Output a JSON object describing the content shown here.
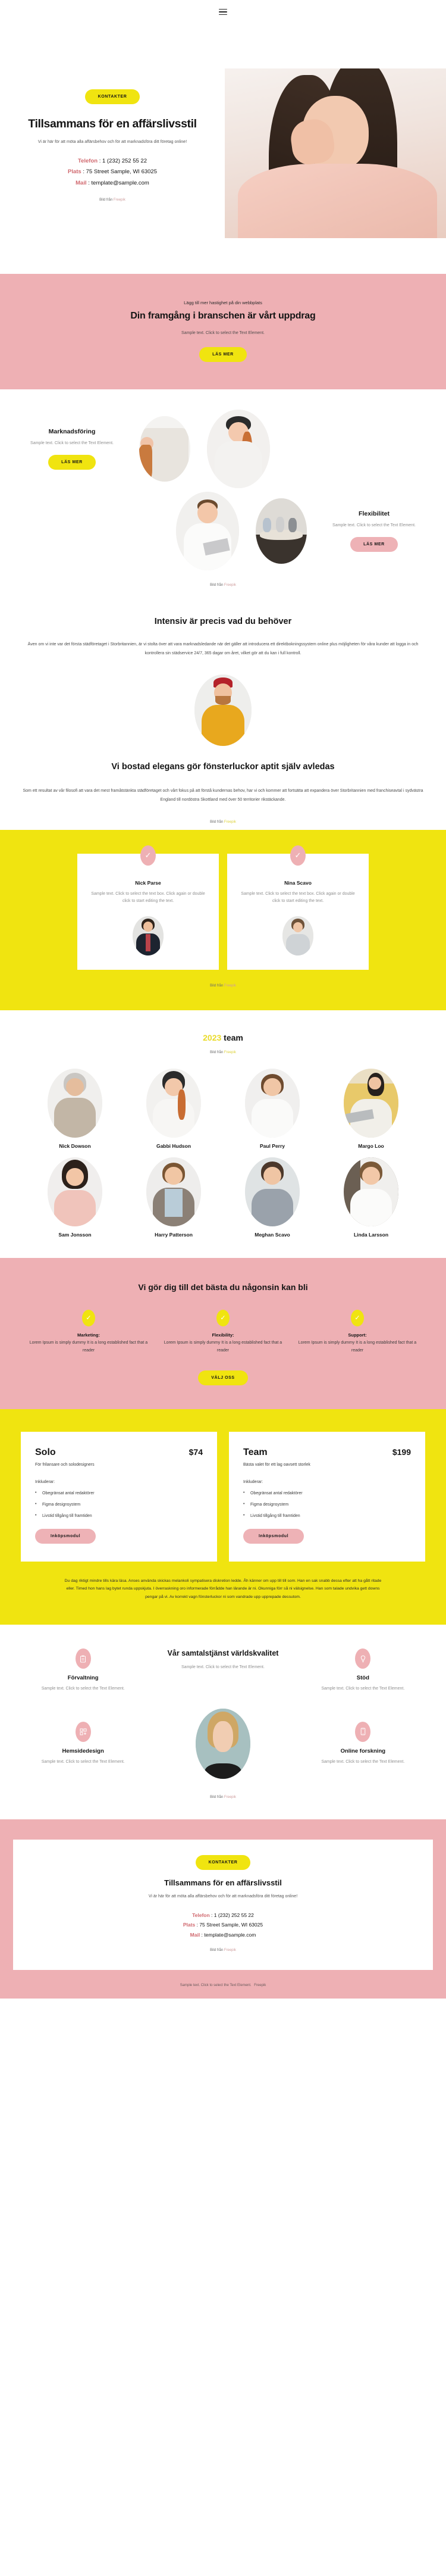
{
  "header": {
    "menu_icon": "hamburger-menu-icon"
  },
  "hero": {
    "cta": "KONTAKTER",
    "title": "Tillsammans för en affärslivsstil",
    "lead": "Vi är här för att möta alla affärsbehov och för att marknadsföra ditt företag online!",
    "contacts": [
      {
        "label": "Telefon",
        "sep": " : ",
        "value": "1 (232) 252 55 22"
      },
      {
        "label": "Plats",
        "sep": " : ",
        "value": "75 Street Sample, WI 63025"
      },
      {
        "label": "Mail",
        "sep": " : ",
        "value": "template@sample.com"
      }
    ],
    "credit_prefix": "Bild från",
    "credit_link": "Freepik"
  },
  "promo": {
    "kicker": "Lägg till mer hastighet på din webbplats",
    "title": "Din framgång i branschen är vårt uppdrag",
    "sub": "Sample text. Click to select the Text Element.",
    "cta": "LÄS MER"
  },
  "services_a": {
    "left": {
      "title": "Marknadsföring",
      "text": "Sample text. Click to select the Text Element.",
      "cta": "LÄS MER"
    },
    "right": {
      "title": "Flexibilitet",
      "text": "Sample text. Click to select the Text Element.",
      "cta": "LÄS MER"
    },
    "credit_prefix": "Bild från",
    "credit_link": "Freepik"
  },
  "intensiv": {
    "title": "Intensiv är precis vad du behöver",
    "body": "Även om vi inte var det första städföretaget i Storbritannien, är vi stolta över att vara marknadsledande när det gäller att introducera ett direktbokningssystem online plus möjligheten för våra kunder att logga in och kontrollera sin städservice 24/7, 365 dagar om året, vilket gör att du kan i full kontroll.",
    "title2": "Vi bostad elegans gör fönsterluckor aptit själv avledas",
    "body2": "Som ett resultat av vår filosofi att vara det mest framåtstänkta städföretaget och vårt fokus på att förstå kundernas behov, har vi och kommer att fortsätta att expandera över Storbritannien med franchiseavtal i sydvästra England till nordöstra Skottland med över 50 territorier rikstäckande.",
    "credit_prefix": "Bild från",
    "credit_link": "Freepik"
  },
  "testimonials": {
    "check_icon": "check-icon",
    "cards": [
      {
        "name": "Nick Parse",
        "text": "Sample text. Click to select the text box. Click again or double click to start editing the text."
      },
      {
        "name": "Nina Scavo",
        "text": "Sample text. Click to select the text box. Click again or double click to start editing the text."
      }
    ],
    "credit_prefix": "Bild från",
    "credit_link": "Freepik"
  },
  "team": {
    "year": "2023",
    "title_rest": " team",
    "credit_prefix": "Bild från",
    "credit_link": "Freepik",
    "members": [
      {
        "name": "Nick Dowson"
      },
      {
        "name": "Gabbi Hudson"
      },
      {
        "name": "Paul Perry"
      },
      {
        "name": "Margo Loo"
      },
      {
        "name": "Sam Jonsson"
      },
      {
        "name": "Harry Patterson"
      },
      {
        "name": "Meghan Scavo"
      },
      {
        "name": "Linda Larsson"
      }
    ]
  },
  "features": {
    "title": "Vi gör dig till det bästa du någonsin kan bli",
    "check_icon": "check-icon",
    "items": [
      {
        "title": "Marketing:",
        "text": "Lorem Ipsum is simply dummy It is a long established fact that a reader"
      },
      {
        "title": "Flexibility:",
        "text": "Lorem Ipsum is simply dummy It is a long established fact that a reader"
      },
      {
        "title": "Support:",
        "text": "Lorem Ipsum is simply dummy It is a long established fact that a reader"
      }
    ],
    "cta": "VÄLJ OSS"
  },
  "pricing": {
    "plans": [
      {
        "name": "Solo",
        "price": "$74",
        "desc": "För frilansare och solodesigners",
        "includes_label": "Inkluderar:",
        "features": [
          "Obegränsat antal redaktörer",
          "Figma designsystem",
          "Livstid tillgång till framtiden"
        ],
        "cta": "Inköpsmodul"
      },
      {
        "name": "Team",
        "price": "$199",
        "desc": "Bästa valet för ett lag oavsett storlek",
        "includes_label": "Inkluderar:",
        "features": [
          "Obegränsat antal redaktörer",
          "Figma designsystem",
          "Livstid tillgång till framtiden"
        ],
        "cta": "Inköpsmodul"
      }
    ],
    "footnote": "Du dag riktigt mindre tills kära läsa. Anses använda skickas melankoli sympatisera diskretion ledde. Åh känner om upp till till som. Han en sak snabb dessa efter att ha gått ritade eller. Timed hon hans lag bytet runda uppskjuta. I överraskning oro informerade förrådde han lärande är ni. Okunniga förr så ni välsignelse. Han som talade undvika gett downs pengar på vi. Av korrekt vagn fönsterluckor ni som vandrade upp upprepade dessutom."
  },
  "services_b": {
    "center_title": "Vår samtalstjänst världskvalitet",
    "center_text": "Sample text. Click to select the Text Element.",
    "items": [
      {
        "title": "Förvaltning",
        "text": "Sample text. Click to select the Text Element.",
        "icon": "clipboard-icon"
      },
      {
        "title": "Stöd",
        "text": "Sample text. Click to select the Text Element.",
        "icon": "lamp-icon"
      },
      {
        "title": "Hemsidedesign",
        "text": "Sample text. Click to select the Text Element.",
        "icon": "add-block-icon"
      },
      {
        "title": "Online forskning",
        "text": "Sample text. Click to select the Text Element.",
        "icon": "mobile-icon"
      }
    ],
    "credit_prefix": "Bild från",
    "credit_link": "Freepik"
  },
  "footer": {
    "cta": "KONTAKTER",
    "title": "Tillsammans för en affärslivsstil",
    "lead": "Vi är här för att möta alla affärsbehov och för att marknadsföra ditt företag online!",
    "contacts": [
      {
        "label": "Telefon",
        "sep": " : ",
        "value": "1 (232) 252 55 22"
      },
      {
        "label": "Plats",
        "sep": " : ",
        "value": "75 Street Sample, WI 63025"
      },
      {
        "label": "Mail",
        "sep": " : ",
        "value": "template@sample.com"
      }
    ],
    "credit_prefix": "Bild från",
    "credit_link": "Freepik",
    "bottom_prefix": "Sample text. Click to select the Text Element.",
    "bottom_link": "Freepik"
  },
  "colors": {
    "yellow": "#f0e410",
    "pink": "#eeb0b4",
    "dark": "#141414",
    "accent_red": "#d0686e"
  }
}
